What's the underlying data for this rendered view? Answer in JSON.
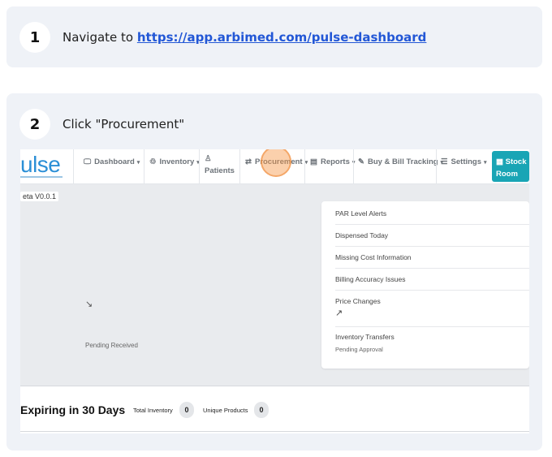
{
  "step1": {
    "number": "1",
    "prefix": "Navigate to ",
    "link": "https://app.arbimed.com/pulse-dashboard"
  },
  "step2": {
    "number": "2",
    "text": "Click \"Procurement\""
  },
  "app": {
    "logo": "ulse",
    "nav": [
      {
        "icon": "🖵",
        "label": "Dashboard",
        "caret": "▾"
      },
      {
        "icon": "♲",
        "label": "Inventory",
        "caret": "▾"
      },
      {
        "icon": "♙",
        "label": "Patients",
        "caret": ""
      },
      {
        "icon": "⇄",
        "label": "Procurement",
        "caret": "▾"
      },
      {
        "icon": "▤",
        "label": "Reports",
        "caret": "▾"
      },
      {
        "icon": "✎",
        "label": "Buy & Bill Tracking",
        "caret": "▾"
      },
      {
        "icon": "☰",
        "label": "Settings",
        "caret": "▾"
      }
    ],
    "stock_room": {
      "icon": "▦",
      "line1": "Stock",
      "line2": "Room"
    },
    "version": "eta V0.0.1",
    "pending_received": "Pending Received",
    "alerts": [
      "PAR Level Alerts",
      "Dispensed Today",
      "Missing Cost Information",
      "Billing Accuracy Issues",
      "Price Changes",
      "Inventory Transfers"
    ],
    "pending_approval": "Pending Approval",
    "trend_down_icon": "↘",
    "trend_up_icon": "↗",
    "expiring_title": "Expiring in 30 Days",
    "total_inventory_label": "Total Inventory",
    "total_inventory_value": "0",
    "unique_products_label": "Unique Products",
    "unique_products_value": "0"
  }
}
